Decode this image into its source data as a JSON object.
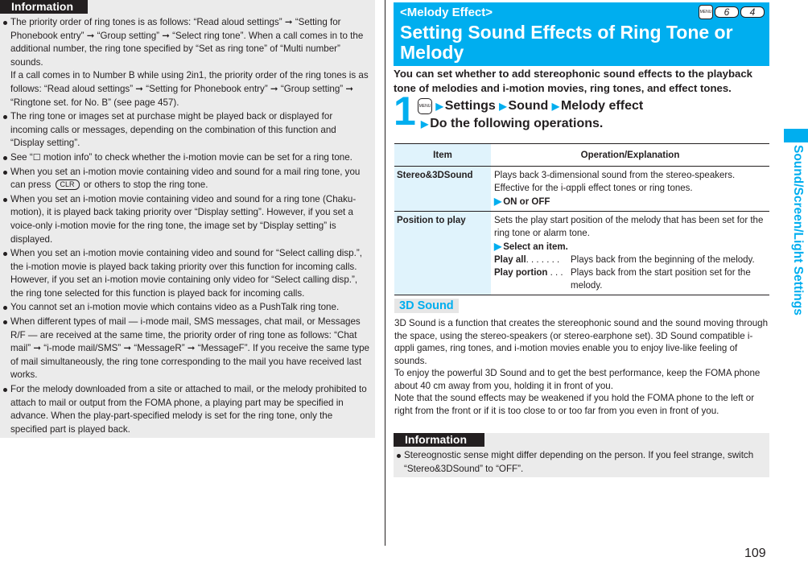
{
  "left_info": {
    "tab_label": "Information",
    "items": [
      {
        "paragraphs": [
          "The priority order of ring tones is as follows: “Read aloud settings” ➞ “Setting for Phonebook entry” ➞ “Group setting” ➞ “Select ring tone”. When a call comes in to the additional number, the ring tone specified by “Set as ring tone” of “Multi number” sounds.",
          "If a call comes in to Number B while using 2in1, the priority order of the ring tones is as follows: “Read aloud settings” ➞ “Setting for Phonebook entry” ➞ “Group setting” ➞ “Ringtone set. for No. B” (see page 457)."
        ]
      },
      {
        "paragraphs": [
          "The ring tone or images set at purchase might be played back or displayed for incoming calls or messages, depending on the combination of this function and “Display setting”."
        ]
      },
      {
        "pre": "See “",
        "glyph": "☐",
        "post": " motion info” to check whether the i-motion movie can be set for a ring tone."
      },
      {
        "pre": "When you set an i-motion movie containing video and sound for a mail ring tone, you can press ",
        "key": "CLR",
        "post": " or others to stop the ring tone."
      },
      {
        "paragraphs": [
          "When you set an i-motion movie containing video and sound for a ring tone (Chaku-motion), it is played back taking priority over “Display setting”. However, if you set a voice-only i-motion movie for the ring tone, the image set by “Display setting” is displayed."
        ]
      },
      {
        "paragraphs": [
          "When you set an i-motion movie containing video and sound for “Select calling disp.”, the i-motion movie is played back taking priority over this function for incoming calls. However, if you set an i-motion movie containing only video for “Select calling disp.”, the ring tone selected for this function is played back for incoming calls."
        ]
      },
      {
        "paragraphs": [
          "You cannot set an i-motion movie which contains video as a PushTalk ring tone."
        ]
      },
      {
        "paragraphs": [
          "When different types of mail — i-mode mail, SMS messages, chat mail, or Messages R/F — are received at the same time, the priority order of ring tone as follows: “Chat mail” ➞ “i-mode mail/SMS” ➞ “MessageR” ➞ “MessageF”. If you receive the same type of mail simultaneously, the ring tone corresponding to the mail you have received last works."
        ]
      },
      {
        "paragraphs": [
          "For the melody downloaded from a site or attached to mail, or the melody prohibited to attach to mail or output from the FOMA phone, a playing part may be specified in advance. When the play-part-specified melody is set for the ring tone, only the specified part is played back."
        ]
      }
    ]
  },
  "header": {
    "subtitle": "<Melody Effect>",
    "title": "Setting Sound Effects of Ring Tone or Melody",
    "keys": {
      "menu": "MENU",
      "k1": "6",
      "k2": "4"
    }
  },
  "intro": "You can set whether to add stereophonic sound effects to the playback tone of melodies and i-motion movies, ring tones, and effect tones.",
  "step": {
    "number": "1",
    "menu_key": "MENU",
    "path": [
      "Settings",
      "Sound",
      "Melody effect"
    ],
    "action": "Do the following operations."
  },
  "table": {
    "headers": [
      "Item",
      "Operation/Explanation"
    ],
    "rows": [
      {
        "item": "Stereo&3DSound",
        "lines": [
          "Plays back 3-dimensional sound from the stereo-speakers.",
          "Effective for the i-αppli effect tones or ring tones."
        ],
        "action": "ON or OFF"
      },
      {
        "item": "Position to play",
        "lines": [
          "Sets the play start position of the melody that has been set for the ring tone or alarm tone."
        ],
        "action": "Select an item.",
        "options": [
          {
            "key": "Play all",
            "dots": ". . . . . . .",
            "desc": "Plays back from the beginning of the melody."
          },
          {
            "key": "Play portion",
            "dots": " . . .",
            "desc": "Plays back from the start position set for the melody."
          }
        ]
      }
    ]
  },
  "section": {
    "heading": "3D Sound",
    "paragraphs": [
      "3D Sound is a function that creates the stereophonic sound and the sound moving through the space, using the stereo-speakers (or stereo-earphone set). 3D Sound compatible i-αppli games, ring tones, and i-motion movies enable you to enjoy live-like feeling of sounds.",
      "To enjoy the powerful 3D Sound and to get the best performance, keep the FOMA phone about 40 cm away from you, holding it in front of you.",
      "Note that the sound effects may be weakened if you hold the FOMA phone to the left or right from the front or if it is too close to or too far from you even in front of you."
    ]
  },
  "right_info": {
    "tab_label": "Information",
    "items": [
      "Stereognostic sense might differ depending on the person. If you feel strange, switch “Stereo&3DSound” to “OFF”."
    ]
  },
  "side_label": "Sound/Screen/Light Settings",
  "page_number": "109",
  "colors": {
    "accent": "#00aeef",
    "info_bg": "#ebebeb",
    "table_item_bg": "#e0f3fc",
    "text": "#231f20"
  }
}
